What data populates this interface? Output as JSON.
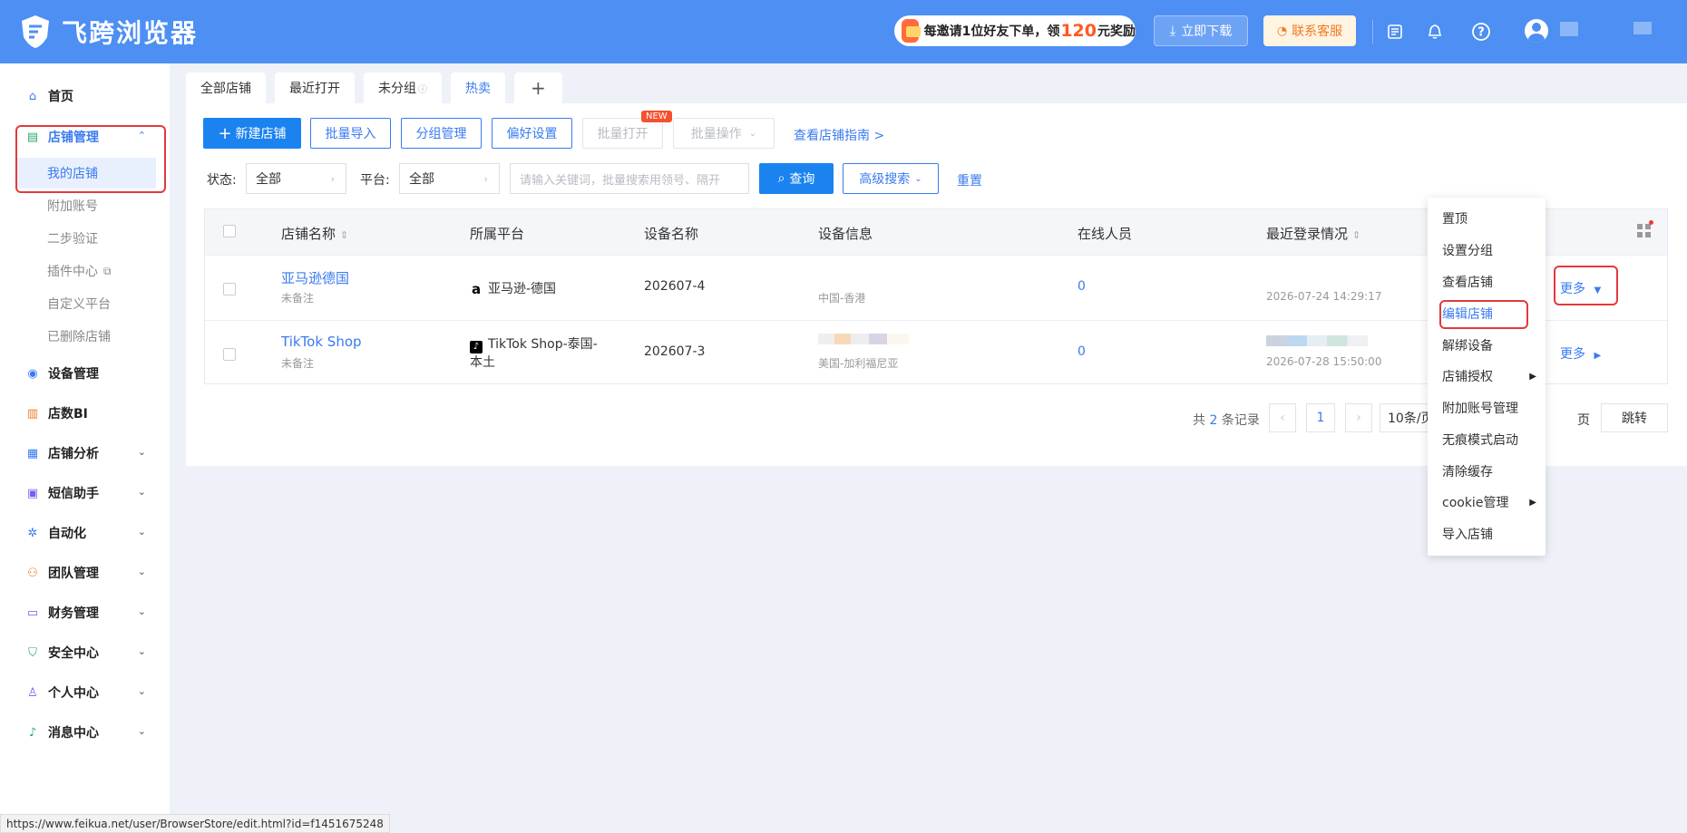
{
  "app": {
    "name": "飞跨浏览器",
    "invite": {
      "prefix": "每邀请1位好友下单，领",
      "amount": "120",
      "suffix": "元奖励"
    },
    "download_label": "立即下载",
    "service_label": "联系客服",
    "accent": "#4d8ff3",
    "primary": "#1a83f0"
  },
  "sidebar": {
    "items": [
      {
        "label": "首页",
        "icon": "home-icon"
      },
      {
        "label": "店铺管理",
        "icon": "store-icon"
      },
      {
        "label": "设备管理",
        "icon": "device-icon"
      },
      {
        "label": "店数BI",
        "icon": "chart-icon"
      },
      {
        "label": "店铺分析",
        "icon": "grid-icon"
      },
      {
        "label": "短信助手",
        "icon": "sms-icon"
      },
      {
        "label": "自动化",
        "icon": "gear-icon"
      },
      {
        "label": "团队管理",
        "icon": "team-icon"
      },
      {
        "label": "财务管理",
        "icon": "wallet-icon"
      },
      {
        "label": "安全中心",
        "icon": "shield-icon"
      },
      {
        "label": "个人中心",
        "icon": "user-icon"
      },
      {
        "label": "消息中心",
        "icon": "bell-icon"
      }
    ],
    "sub_items": [
      "我的店铺",
      "附加账号",
      "二步验证",
      "插件中心",
      "自定义平台",
      "已删除店铺"
    ]
  },
  "tabs": [
    "全部店铺",
    "最近打开",
    "未分组",
    "热卖",
    "+"
  ],
  "toolbar": {
    "new_store": "新建店铺",
    "batch_import": "批量导入",
    "group_manage": "分组管理",
    "preferences": "偏好设置",
    "batch_open": "批量打开",
    "new_badge": "NEW",
    "batch_ops": "批量操作",
    "guide_link": "查看店铺指南 >"
  },
  "filters": {
    "status_label": "状态:",
    "status_value": "全部",
    "platform_label": "平台:",
    "platform_value": "全部",
    "search_placeholder": "请输入关键词，批量搜索用领号、隔开",
    "query": "查询",
    "advanced": "高级搜索",
    "reset": "重置"
  },
  "table": {
    "headers": [
      "店铺名称",
      "所属平台",
      "设备名称",
      "设备信息",
      "在线人员",
      "最近登录情况"
    ],
    "rows": [
      {
        "name": "亚马逊德国",
        "note": "未备注",
        "platform": "亚马逊-德国",
        "device": "202607-4",
        "location": "中国-香港",
        "online": "0",
        "login_time": "2026-07-24 14:29:17",
        "more": "更多"
      },
      {
        "name": "TikTok Shop",
        "note": "未备注",
        "platform": "TikTok Shop-泰国-本土",
        "device": "202607-3",
        "location": "美国-加利福尼亚",
        "online": "0",
        "login_time": "2026-07-28 15:50:00",
        "more": "更多"
      }
    ]
  },
  "pagination": {
    "total_prefix": "共",
    "total": "2",
    "total_suffix": "条记录",
    "page": "1",
    "page_size": "10条/页",
    "page_unit": "页",
    "jump": "跳转"
  },
  "menu": {
    "items": [
      {
        "label": "置顶"
      },
      {
        "label": "设置分组"
      },
      {
        "label": "查看店铺"
      },
      {
        "label": "编辑店铺"
      },
      {
        "label": "解绑设备"
      },
      {
        "label": "店铺授权"
      },
      {
        "label": "附加账号管理"
      },
      {
        "label": "无痕模式启动"
      },
      {
        "label": "清除缓存"
      },
      {
        "label": "cookie管理"
      },
      {
        "label": "导入店铺"
      }
    ]
  },
  "status_url": "https://www.feikua.net/user/BrowserStore/edit.html?id=f1451675248"
}
